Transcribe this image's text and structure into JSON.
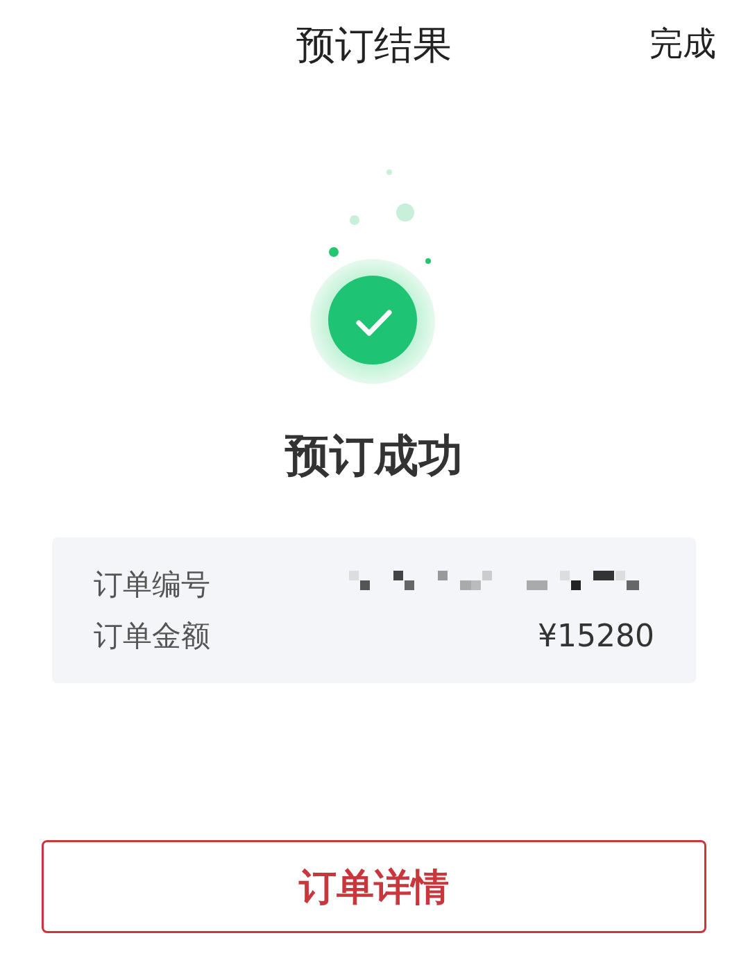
{
  "header": {
    "title": "预订结果",
    "done": "完成"
  },
  "result": {
    "title": "预订成功"
  },
  "details": [
    {
      "kind": "redacted",
      "label": "订单编号"
    },
    {
      "kind": "text",
      "label": "订单金额",
      "value": "¥15280"
    }
  ],
  "button": {
    "label": "订单详情"
  }
}
